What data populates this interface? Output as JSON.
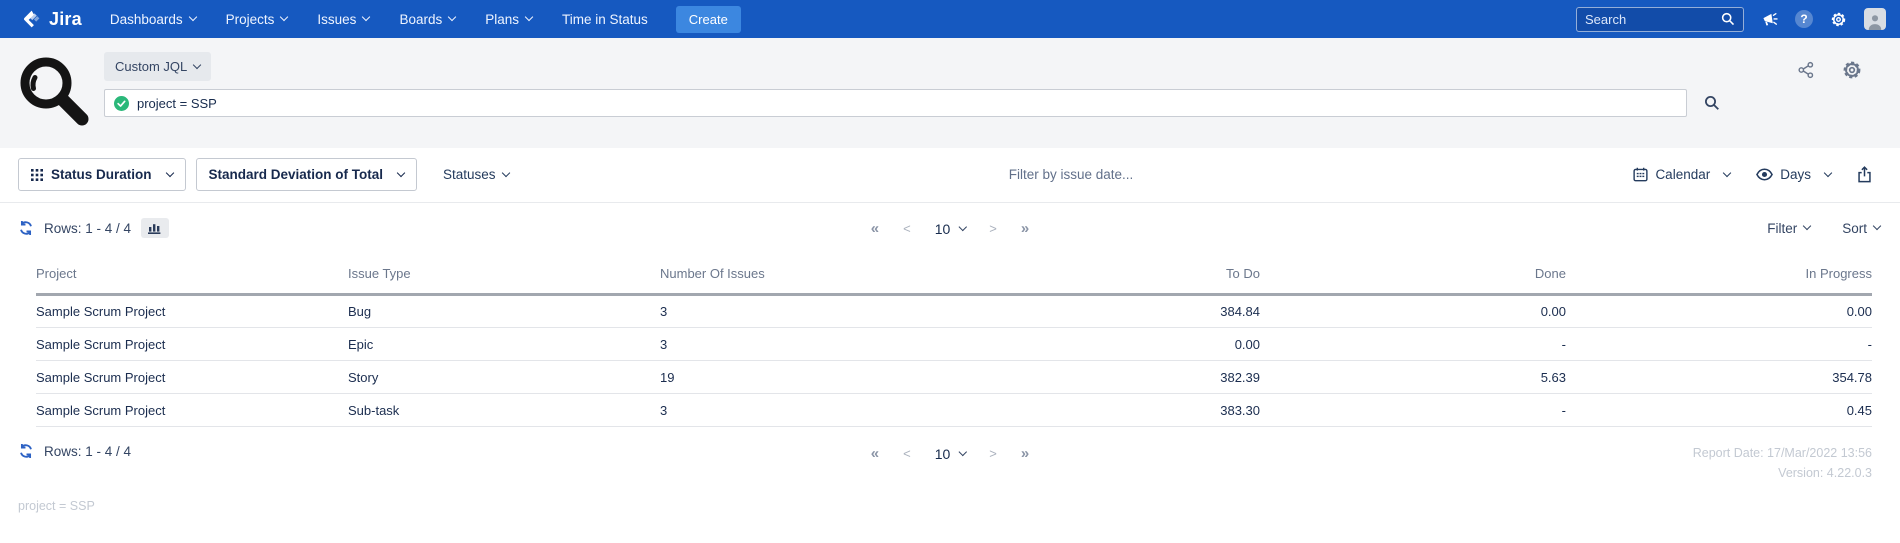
{
  "nav": {
    "brand": "Jira",
    "items": [
      {
        "label": "Dashboards",
        "dropdown": true
      },
      {
        "label": "Projects",
        "dropdown": true
      },
      {
        "label": "Issues",
        "dropdown": true
      },
      {
        "label": "Boards",
        "dropdown": true
      },
      {
        "label": "Plans",
        "dropdown": true
      },
      {
        "label": "Time in Status",
        "dropdown": false
      }
    ],
    "create_label": "Create",
    "search_placeholder": "Search"
  },
  "query": {
    "mode_label": "Custom JQL",
    "jql": "project = SSP"
  },
  "toolbar": {
    "view_label": "Status Duration",
    "metric_label": "Standard Deviation of Total",
    "statuses_label": "Statuses",
    "date_filter_placeholder": "Filter by issue date...",
    "calendar_label": "Calendar",
    "unit_label": "Days"
  },
  "list_controls": {
    "rows_label": "Rows: 1 - 4 / 4",
    "filter_label": "Filter",
    "sort_label": "Sort"
  },
  "pagination": {
    "first": "«",
    "prev": "<",
    "page_size": "10",
    "next": ">",
    "last": "»"
  },
  "table": {
    "columns": [
      {
        "label": "Project",
        "align": "left"
      },
      {
        "label": "Issue Type",
        "align": "left"
      },
      {
        "label": "Number Of Issues",
        "align": "left"
      },
      {
        "label": "To Do",
        "align": "right"
      },
      {
        "label": "Done",
        "align": "right"
      },
      {
        "label": "In Progress",
        "align": "right"
      }
    ],
    "rows": [
      [
        "Sample Scrum Project",
        "Bug",
        "3",
        "384.84",
        "0.00",
        "0.00"
      ],
      [
        "Sample Scrum Project",
        "Epic",
        "3",
        "0.00",
        "-",
        "-"
      ],
      [
        "Sample Scrum Project",
        "Story",
        "19",
        "382.39",
        "5.63",
        "354.78"
      ],
      [
        "Sample Scrum Project",
        "Sub-task",
        "3",
        "383.30",
        "-",
        "0.45"
      ]
    ]
  },
  "footer": {
    "rows_label": "Rows: 1 - 4 / 4",
    "report_date": "Report Date: 17/Mar/2022 13:56",
    "version": "Version: 4.22.0.3",
    "jql_echo": "project = SSP"
  },
  "colors": {
    "nav_bg": "#1659c0",
    "create_bg": "#3c87e0",
    "accent_blue": "#2d62c4",
    "success_green": "#2bb87a"
  }
}
